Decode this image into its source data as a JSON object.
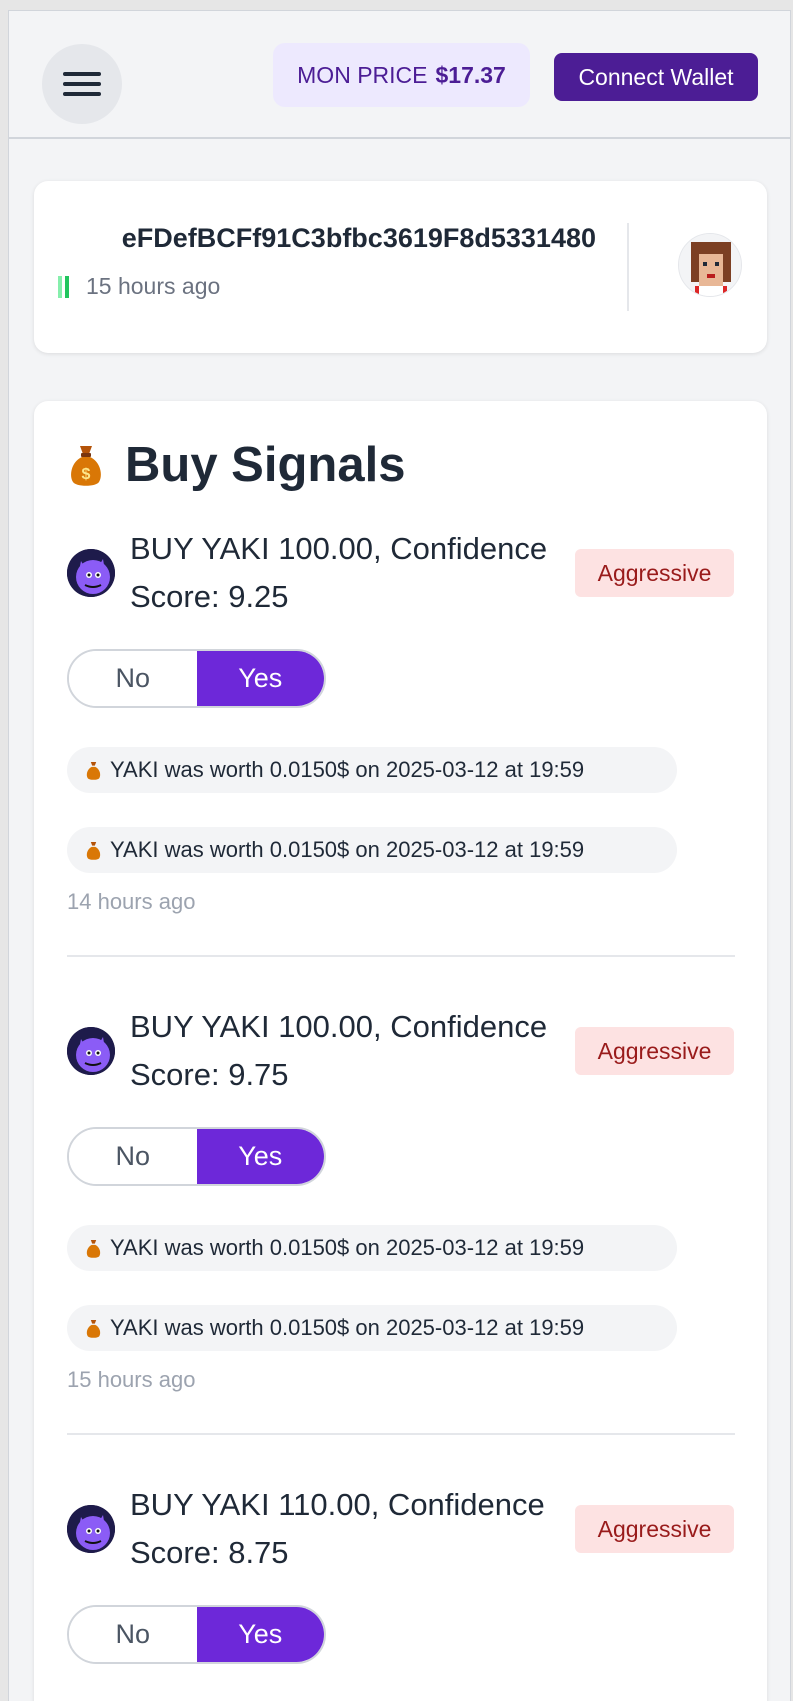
{
  "header": {
    "menu_icon": "hamburger-menu-icon",
    "price_label": "MON PRICE",
    "price_value": "$17.37",
    "connect_label": "Connect Wallet"
  },
  "wallet": {
    "address": "eFDefBCFf91C3bfbc3619F8d5331480",
    "time": "15 hours ago",
    "avatar_icon": "pixel-avatar-icon"
  },
  "signals": {
    "title": "Buy Signals",
    "title_icon": "money-bag-icon",
    "colors": {
      "accent": "#6d28d9",
      "brand": "#4c1d95",
      "badge_bg": "#fde2e2",
      "badge_text": "#991b1b"
    },
    "items": [
      {
        "text": "BUY YAKI 100.00, Confidence Score: 9.25",
        "badge": "Aggressive",
        "no_label": "No",
        "yes_label": "Yes",
        "selected": "Yes",
        "notes": [
          "YAKI was worth 0.0150$ on 2025-03-12 at 19:59",
          "YAKI was worth 0.0150$ on 2025-03-12 at 19:59"
        ],
        "time": "14 hours ago"
      },
      {
        "text": "BUY YAKI 100.00, Confidence Score: 9.75",
        "badge": "Aggressive",
        "no_label": "No",
        "yes_label": "Yes",
        "selected": "Yes",
        "notes": [
          "YAKI was worth 0.0150$ on 2025-03-12 at 19:59",
          "YAKI was worth 0.0150$ on 2025-03-12 at 19:59"
        ],
        "time": "15 hours ago"
      },
      {
        "text": "BUY YAKI 110.00, Confidence Score: 8.75",
        "badge": "Aggressive",
        "no_label": "No",
        "yes_label": "Yes",
        "selected": "Yes"
      }
    ]
  }
}
